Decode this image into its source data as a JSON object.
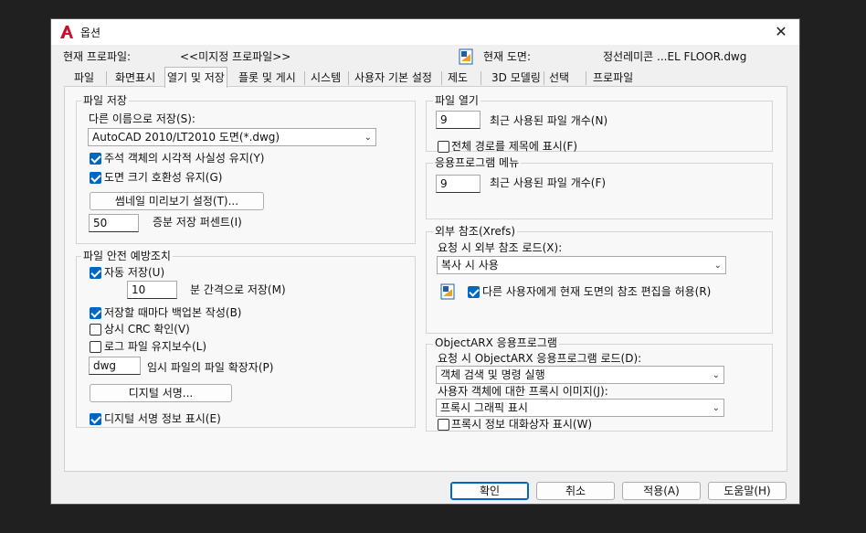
{
  "window": {
    "title": "옵션",
    "close": "✕"
  },
  "profile": {
    "current_profile_label": "현재 프로파일:",
    "current_profile_value": "<<미지정 프로파일>>",
    "current_drawing_label": "현재 도면:",
    "current_drawing_value": "정선레미콘 ...EL FLOOR.dwg"
  },
  "tabs": [
    "파일",
    "화면표시",
    "열기 및 저장",
    "플롯 및 게시",
    "시스템",
    "사용자 기본 설정",
    "제도",
    "3D 모델링",
    "선택",
    "프로파일"
  ],
  "file_save": {
    "title": "파일 저장",
    "save_as_label": "다른 이름으로 저장(S):",
    "save_as_value": "AutoCAD 2010/LT2010 도면(*.dwg)",
    "cb_annotative": "주석 객체의 시각적 사실성 유지(Y)",
    "cb_drawing_size": "도면 크기 호환성 유지(G)",
    "thumbnail_button": "썸네일 미리보기 설정(T)...",
    "incremental_value": "50",
    "incremental_label": "증분 저장 퍼센트(I)"
  },
  "file_safety": {
    "title": "파일 안전 예방조치",
    "cb_autosave": "자동 저장(U)",
    "minutes_value": "10",
    "minutes_label": "분 간격으로 저장(M)",
    "cb_backup": "저장할 때마다 백업본 작성(B)",
    "cb_crc": "상시 CRC 확인(V)",
    "cb_log": "로그 파일 유지보수(L)",
    "temp_ext_value": "dwg",
    "temp_ext_label": "임시 파일의 파일 확장자(P)",
    "digital_sig_button": "디지털 서명...",
    "cb_digital_info": "디지털 서명 정보 표시(E)"
  },
  "file_open": {
    "title": "파일 열기",
    "recent_value": "9",
    "recent_label": "최근 사용된 파일 개수(N)",
    "cb_full_path": "전체 경로를 제목에 표시(F)"
  },
  "app_menu": {
    "title": "응용프로그램 메뉴",
    "recent_value": "9",
    "recent_label": "최근 사용된 파일 개수(F)"
  },
  "xrefs": {
    "title": "외부 참조(Xrefs)",
    "demand_label": "요청 시 외부 참조 로드(X):",
    "demand_value": "복사 시 사용",
    "cb_allow_edit": "다른 사용자에게 현재 도면의 참조 편집을 허용(R)"
  },
  "objectarx": {
    "title": "ObjectARX 응용프로그램",
    "demand_label": "요청 시 ObjectARX 응용프로그램 로드(D):",
    "demand_value": "객체 검색 및 명령 실행",
    "proxy_label": "사용자 객체에 대한 프록시 이미지(J):",
    "proxy_value": "프록시 그래픽 표시",
    "cb_proxy_dialog": "프록시 정보 대화상자 표시(W)"
  },
  "footer": {
    "ok": "확인",
    "cancel": "취소",
    "apply": "적용(A)",
    "help": "도움말(H)"
  },
  "colors": {
    "accent": "#0067c0",
    "autocad_red": "#c8102e"
  }
}
